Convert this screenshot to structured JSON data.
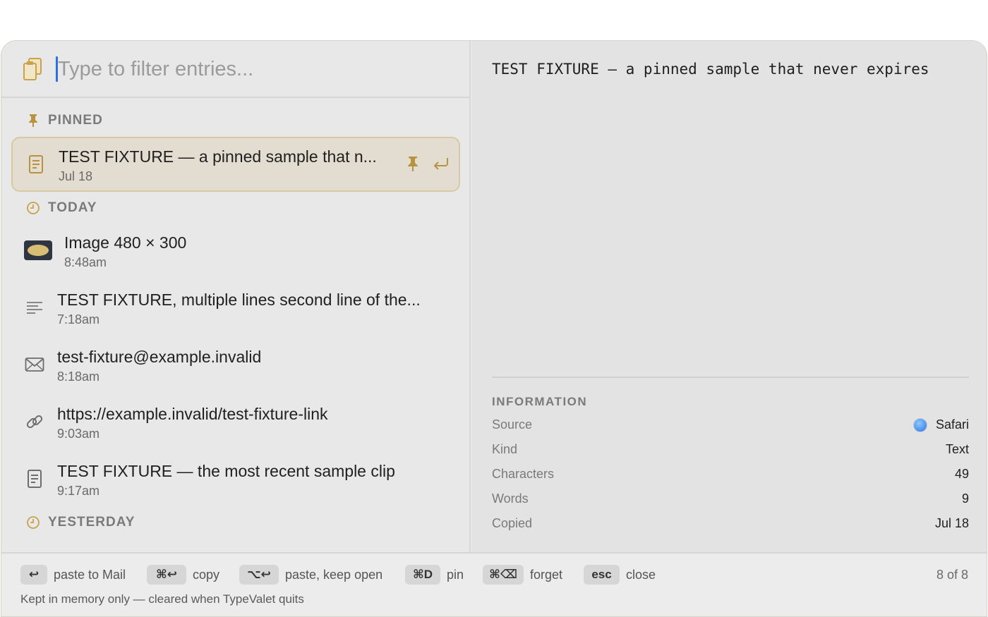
{
  "search": {
    "placeholder": "Type to filter entries..."
  },
  "sections": {
    "pinned": "PINNED",
    "today": "TODAY",
    "yesterday": "YESTERDAY"
  },
  "entries": [
    {
      "title": "TEST FIXTURE — a pinned sample that n...",
      "time": "Jul 18",
      "icon": "document-icon",
      "selected": true
    },
    {
      "title": "Image 480 × 300",
      "time": "8:48am",
      "icon": "image-thumbnail"
    },
    {
      "title": "TEST FIXTURE, multiple lines second line of the...",
      "time": "7:18am",
      "icon": "text-lines-icon"
    },
    {
      "title": "test-fixture@example.invalid",
      "time": "8:18am",
      "icon": "envelope-icon"
    },
    {
      "title": "https://example.invalid/test-fixture-link",
      "time": "9:03am",
      "icon": "link-icon"
    },
    {
      "title": "TEST FIXTURE — the most recent sample clip",
      "time": "9:17am",
      "icon": "document-icon"
    }
  ],
  "preview": {
    "text": "TEST FIXTURE — a pinned sample that never expires"
  },
  "info": {
    "title": "INFORMATION",
    "rows": [
      {
        "key": "Source",
        "value": "Safari"
      },
      {
        "key": "Kind",
        "value": "Text"
      },
      {
        "key": "Characters",
        "value": "49"
      },
      {
        "key": "Words",
        "value": "9"
      },
      {
        "key": "Copied",
        "value": "Jul 18"
      }
    ]
  },
  "footer": {
    "hints": [
      {
        "key": "↩",
        "label": "paste to Mail"
      },
      {
        "key": "⌘↩",
        "label": "copy"
      },
      {
        "key": "⌥↩",
        "label": "paste, keep open"
      },
      {
        "key": "⌘D",
        "label": "pin"
      },
      {
        "key": "⌘⌫",
        "label": "forget"
      },
      {
        "key": "esc",
        "label": "close"
      }
    ],
    "count": "8 of 8",
    "note": "Kept in memory only — cleared when TypeValet quits"
  },
  "colors": {
    "accent": "#c9a24a",
    "caret": "#2f6fe4",
    "selected_bg": "#e3ddd1"
  }
}
